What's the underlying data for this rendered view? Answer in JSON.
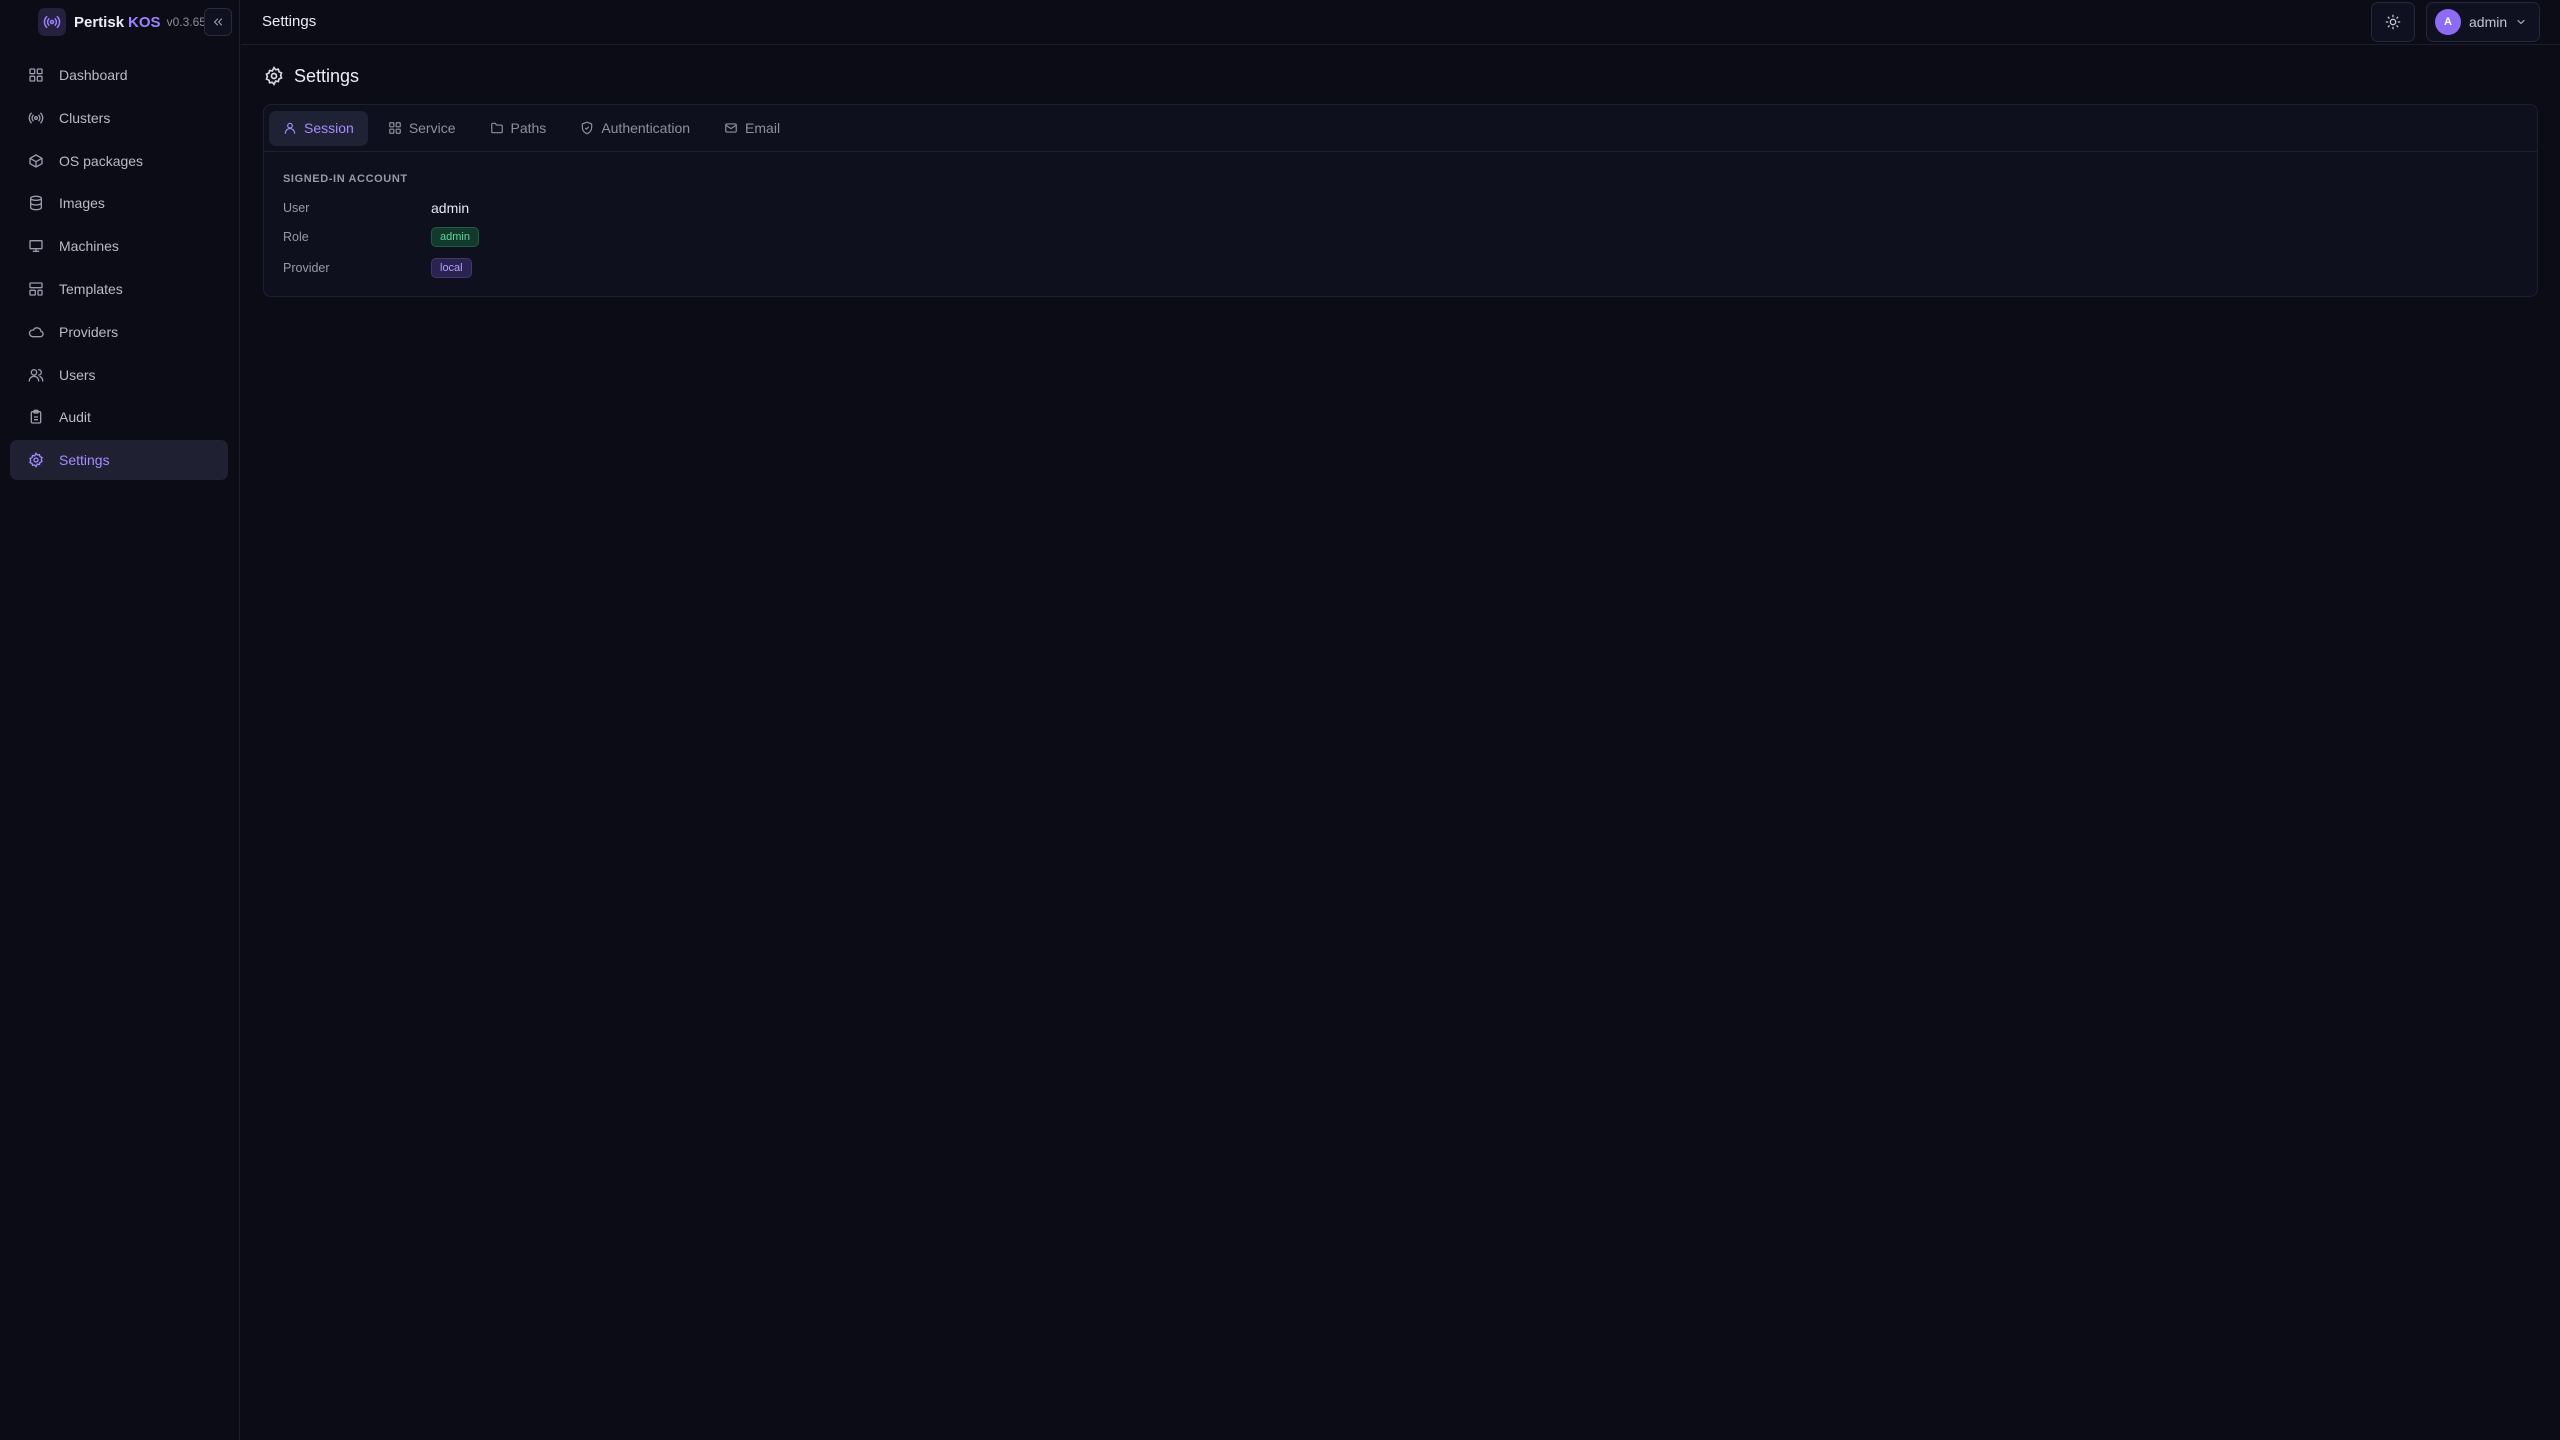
{
  "brand": {
    "name": "Pertisk",
    "product": "KOS",
    "version": "v0.3.65"
  },
  "sidebar": {
    "items": [
      {
        "label": "Dashboard",
        "icon": "grid-icon"
      },
      {
        "label": "Clusters",
        "icon": "broadcast-icon"
      },
      {
        "label": "OS packages",
        "icon": "package-icon"
      },
      {
        "label": "Images",
        "icon": "database-icon"
      },
      {
        "label": "Machines",
        "icon": "monitor-icon"
      },
      {
        "label": "Templates",
        "icon": "layout-icon"
      },
      {
        "label": "Providers",
        "icon": "cloud-icon"
      },
      {
        "label": "Users",
        "icon": "users-icon"
      },
      {
        "label": "Audit",
        "icon": "clipboard-icon"
      },
      {
        "label": "Settings",
        "icon": "gear-icon",
        "active": true
      }
    ]
  },
  "topbar": {
    "title": "Settings",
    "theme_icon": "sun-icon",
    "user": {
      "initial": "A",
      "name": "admin"
    }
  },
  "page": {
    "title": "Settings",
    "icon": "gear-icon"
  },
  "tabs": [
    {
      "label": "Session",
      "icon": "user-icon",
      "active": true
    },
    {
      "label": "Service",
      "icon": "grid-icon"
    },
    {
      "label": "Paths",
      "icon": "folder-icon"
    },
    {
      "label": "Authentication",
      "icon": "shield-icon"
    },
    {
      "label": "Email",
      "icon": "mail-icon"
    }
  ],
  "session": {
    "section_label": "SIGNED-IN ACCOUNT",
    "rows": [
      {
        "key": "User",
        "value": "admin"
      },
      {
        "key": "Role",
        "value": "admin"
      },
      {
        "key": "Provider",
        "value": "local"
      }
    ]
  },
  "colors": {
    "background": "#0b0c16",
    "accent": "#a48cff",
    "role_badge": "#5fd59c",
    "provider_badge": "#b3a0ff"
  }
}
